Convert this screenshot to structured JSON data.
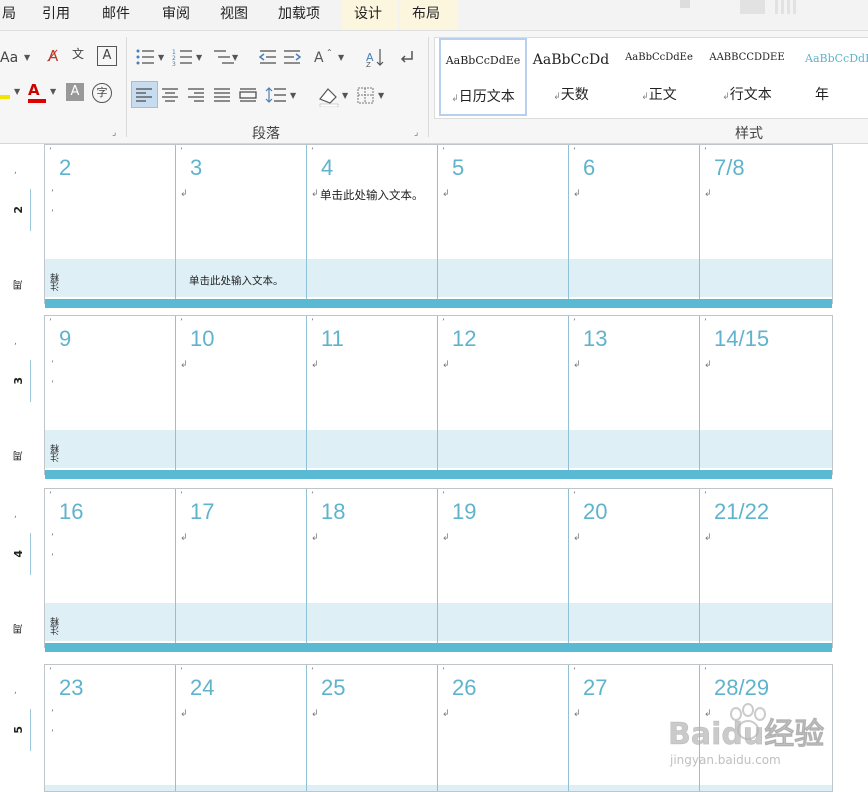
{
  "tabs": [
    {
      "label": "局"
    },
    {
      "label": "引用"
    },
    {
      "label": "邮件"
    },
    {
      "label": "审阅"
    },
    {
      "label": "视图"
    },
    {
      "label": "加载项"
    },
    {
      "label": "设计"
    },
    {
      "label": "布局"
    }
  ],
  "ribbon": {
    "font_group_label": "Aa",
    "paragraph_label": "段落",
    "styles_label": "样式",
    "styles": [
      {
        "sample": "AaBbCcDdEe",
        "name": "日历文本"
      },
      {
        "sample": "AaBbCcDd",
        "name": "天数"
      },
      {
        "sample": "AaBbCcDdEe",
        "name": "正文"
      },
      {
        "sample": "AABBCCDDEE",
        "name": "行文本"
      },
      {
        "sample": "AaBbCcDdE",
        "name": "年"
      }
    ]
  },
  "calendar": {
    "placeholder": "单击此处输入文本。",
    "notes_label": "注释",
    "week_word": "周",
    "weeks": [
      {
        "week_no": "2",
        "days": [
          "2",
          "3",
          "4",
          "5",
          "6",
          "7/8"
        ]
      },
      {
        "week_no": "3",
        "days": [
          "9",
          "10",
          "11",
          "12",
          "13",
          "14/15"
        ]
      },
      {
        "week_no": "4",
        "days": [
          "16",
          "17",
          "18",
          "19",
          "20",
          "21/22"
        ]
      },
      {
        "week_no": "5",
        "days": [
          "23",
          "24",
          "25",
          "26",
          "27",
          "28/29"
        ]
      }
    ]
  },
  "watermark": {
    "brand": "Baidu经验",
    "url": "jingyan.baidu.com"
  },
  "colors": {
    "accent": "#5bbad3",
    "day_number": "#5fb3cd",
    "notes_bg": "#def0f6"
  }
}
